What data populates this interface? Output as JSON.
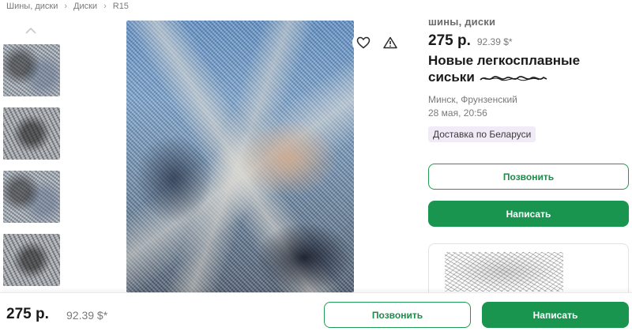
{
  "breadcrumb": {
    "items": [
      "Шины, диски",
      "Диски",
      "R15"
    ],
    "separator": "›"
  },
  "gallery": {
    "up_icon": "chevron-up-icon",
    "favorite_icon": "heart-icon",
    "report_icon": "warning-triangle-icon"
  },
  "listing": {
    "category": "шины, диски",
    "price": "275 р.",
    "price_usd": "92.39 $*",
    "title": "Новые легкосплавные сиськи",
    "location": "Минск, Фрунзенский",
    "date": "28 мая, 20:56",
    "delivery_badge": "Доставка по Беларуси"
  },
  "actions": {
    "call_label": "Позвонить",
    "write_label": "Написать"
  },
  "bottom_bar": {
    "price": "275 р.",
    "price_usd": "92.39 $*",
    "call_label": "Позвонить",
    "write_label": "Написать"
  },
  "colors": {
    "accent_green": "#1a9550",
    "badge_bg": "#f1ebf7"
  }
}
